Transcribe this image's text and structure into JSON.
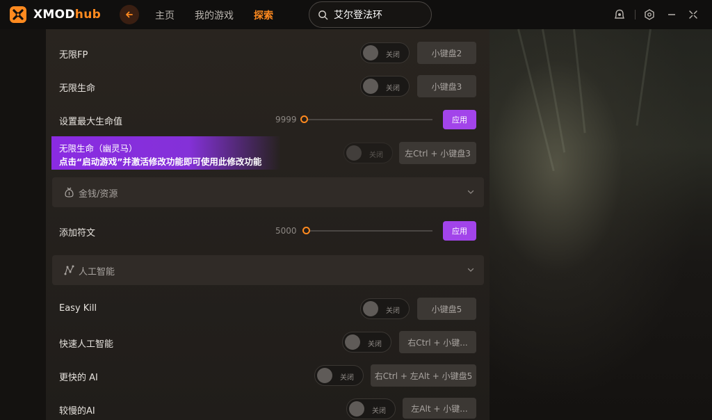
{
  "app": {
    "logo_x": "XMOD",
    "logo_hub": "hub",
    "brand_color": "#ff8a1f",
    "accent_color": "#a244ea"
  },
  "nav": {
    "home": "主页",
    "my_games": "我的游戏",
    "explore": "探索",
    "active": "explore"
  },
  "search": {
    "value": "艾尔登法环"
  },
  "window_icons": [
    "support-icon",
    "settings-icon",
    "minimize-icon",
    "close-icon"
  ],
  "toggle_off_label": "关闭",
  "apply_label": "应用",
  "rows": {
    "infinite_fp": {
      "label": "无限FP",
      "hotkey": "小键盘2",
      "state": "off"
    },
    "infinite_health": {
      "label": "无限生命",
      "hotkey": "小键盘3",
      "state": "off"
    },
    "max_health": {
      "label": "设置最大生命值",
      "value": "9999",
      "slider_fraction": 0
    },
    "ghost_health": {
      "label": "无限生命（幽灵马）",
      "hotkey": "左Ctrl + 小键盘3",
      "state": "off"
    },
    "add_runes": {
      "label": "添加符文",
      "value": "5000",
      "slider_fraction": 0
    },
    "easy_kill": {
      "label": "Easy Kill",
      "hotkey": "小键盘5",
      "state": "off"
    },
    "fast_ai": {
      "label": "快速人工智能",
      "hotkey": "右Ctrl + 小键...",
      "state": "off"
    },
    "faster_ai": {
      "label": "更快的 AI",
      "hotkey": "右Ctrl + 左Alt + 小键盘5",
      "state": "off"
    },
    "slower_ai": {
      "label": "较慢的AI",
      "hotkey": "左Alt + 小键...",
      "state": "off"
    }
  },
  "promo": {
    "title": "无限生命（幽灵马）",
    "message": "点击“启动游戏”并激活修改功能即可使用此修改功能"
  },
  "sections": {
    "money": {
      "title": "金钱/资源",
      "icon": "money-bag-icon"
    },
    "ai": {
      "title": "人工智能",
      "icon": "ai-icon"
    }
  }
}
